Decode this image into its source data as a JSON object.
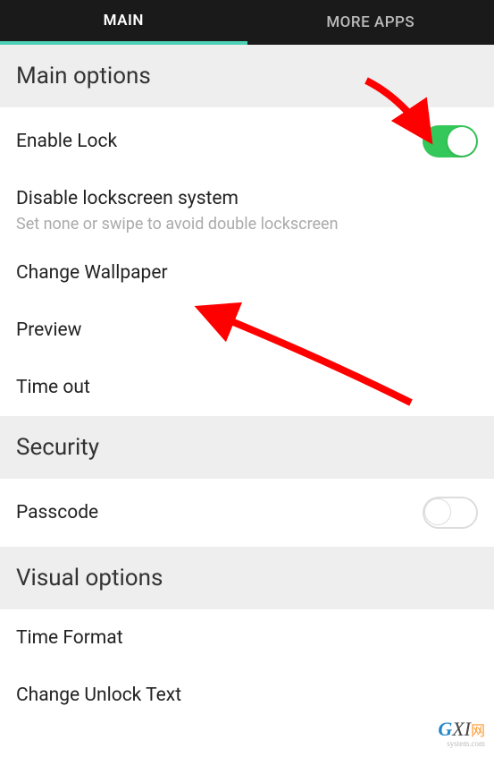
{
  "tabs": {
    "main": "MAIN",
    "more_apps": "MORE APPS"
  },
  "sections": {
    "main_options": {
      "title": "Main options",
      "items": {
        "enable_lock": {
          "label": "Enable Lock",
          "enabled": true
        },
        "disable_lockscreen": {
          "label": "Disable lockscreen system",
          "subtitle": "Set none or swipe to avoid double lockscreen"
        },
        "change_wallpaper": {
          "label": "Change Wallpaper"
        },
        "preview": {
          "label": "Preview"
        },
        "time_out": {
          "label": "Time out"
        }
      }
    },
    "security": {
      "title": "Security",
      "items": {
        "passcode": {
          "label": "Passcode",
          "enabled": false
        }
      }
    },
    "visual_options": {
      "title": "Visual options",
      "items": {
        "time_format": {
          "label": "Time Format"
        },
        "change_unlock_text": {
          "label": "Change Unlock Text"
        }
      }
    }
  },
  "watermark": {
    "brand_g": "G",
    "brand_xi": "XI",
    "brand_net": "网",
    "sub": "system.com"
  },
  "annotations": {
    "arrow_color": "#ff0000"
  }
}
